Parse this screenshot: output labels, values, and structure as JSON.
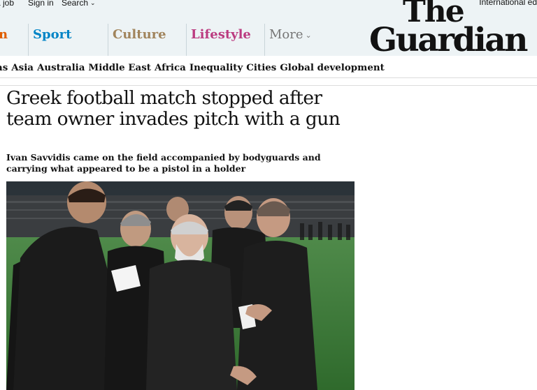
{
  "topbar": {
    "job_link": "a job",
    "signin_link": "Sign in",
    "search_link": "Search",
    "edition": "International ed"
  },
  "logo": {
    "line1": "The",
    "line2": "Guardian"
  },
  "pillars": [
    {
      "label": "n"
    },
    {
      "label": "Sport"
    },
    {
      "label": "Culture"
    },
    {
      "label": "Lifestyle"
    },
    {
      "label": "More"
    }
  ],
  "subnav": [
    "ras",
    "Asia",
    "Australia",
    "Middle East",
    "Africa",
    "Inequality",
    "Cities",
    "Global development"
  ],
  "article": {
    "headline": "Greek football match stopped after team owner invades pitch with a gun",
    "standfirst": "Ivan Savvidis came on the field accompanied by bodyguards and carrying what appeared to be a pistol in a holder"
  },
  "colors": {
    "header_bg": "#edf3f5",
    "opinion": "#e05e00",
    "sport": "#0084c6",
    "culture": "#a1845c",
    "lifestyle": "#bb3b80",
    "more": "#767676"
  },
  "icons": {
    "search_chevron": "chevron-down-icon",
    "more_chevron": "chevron-down-icon"
  }
}
